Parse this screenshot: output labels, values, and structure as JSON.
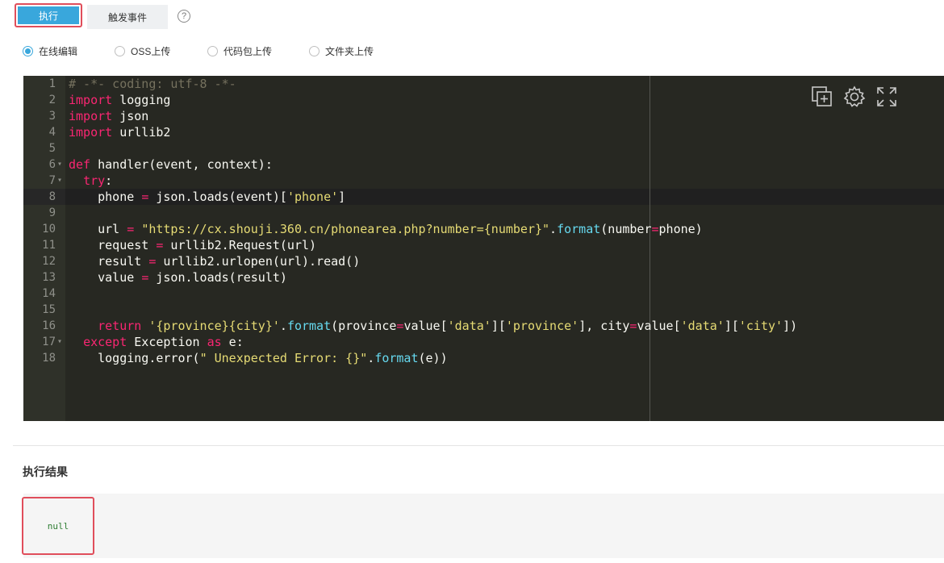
{
  "tabs": {
    "run": "执行",
    "trigger": "触发事件",
    "help": "?"
  },
  "radios": [
    {
      "label": "在线编辑",
      "checked": true
    },
    {
      "label": "OSS上传",
      "checked": false
    },
    {
      "label": "代码包上传",
      "checked": false
    },
    {
      "label": "文件夹上传",
      "checked": false
    }
  ],
  "editor": {
    "lines": [
      {
        "n": "1",
        "fold": ""
      },
      {
        "n": "2",
        "fold": ""
      },
      {
        "n": "3",
        "fold": ""
      },
      {
        "n": "4",
        "fold": ""
      },
      {
        "n": "5",
        "fold": ""
      },
      {
        "n": "6",
        "fold": "▾"
      },
      {
        "n": "7",
        "fold": "▾"
      },
      {
        "n": "8",
        "fold": ""
      },
      {
        "n": "9",
        "fold": ""
      },
      {
        "n": "10",
        "fold": ""
      },
      {
        "n": "11",
        "fold": ""
      },
      {
        "n": "12",
        "fold": ""
      },
      {
        "n": "13",
        "fold": ""
      },
      {
        "n": "14",
        "fold": ""
      },
      {
        "n": "15",
        "fold": ""
      },
      {
        "n": "16",
        "fold": ""
      },
      {
        "n": "17",
        "fold": "▾"
      },
      {
        "n": "18",
        "fold": ""
      }
    ],
    "t": {
      "l1": "# -*- coding: utf-8 -*-",
      "import": "import",
      "logging": " logging",
      "json": " json",
      "urllib2": " urllib2",
      "def": "def",
      "handler_sig": " handler(event, context):",
      "try": "try",
      "colon": ":",
      "phone_var": "phone ",
      "eq": "=",
      "json_loads_event": " json.loads(event)[",
      "phone_str": "'phone'",
      "close_br": "]",
      "url_var": "url ",
      "url_str": "\"https://cx.shouji.360.cn/phonearea.php?number={number}\"",
      "dot": ".",
      "format": "format",
      "number_kw": "(number",
      "phone_close": "phone)",
      "request_var": "request ",
      "request_call": " urllib2.Request(url)",
      "result_var": "result ",
      "result_call": " urllib2.urlopen(url).read()",
      "value_var": "value ",
      "value_call": " json.loads(result)",
      "return": "return",
      "ret_str": " '{province}{city}'",
      "province_kw": "(province",
      "value_ref": "value[",
      "data_str": "'data'",
      "mid_br": "][",
      "province_str": "'province'",
      "city_part": "], city",
      "city_str": "'city'",
      "end_paren": "])",
      "except": "except",
      "exc_name": " Exception ",
      "as": "as",
      "e_colon": " e:",
      "log_call": "logging.error(",
      "err_str": "\" Unexpected Error: {}\"",
      "e_close": "(e))"
    }
  },
  "toolbar_icons": [
    "copy-add-icon",
    "gear-icon",
    "expand-icon"
  ],
  "result": {
    "title": "执行结果",
    "value": "null"
  }
}
